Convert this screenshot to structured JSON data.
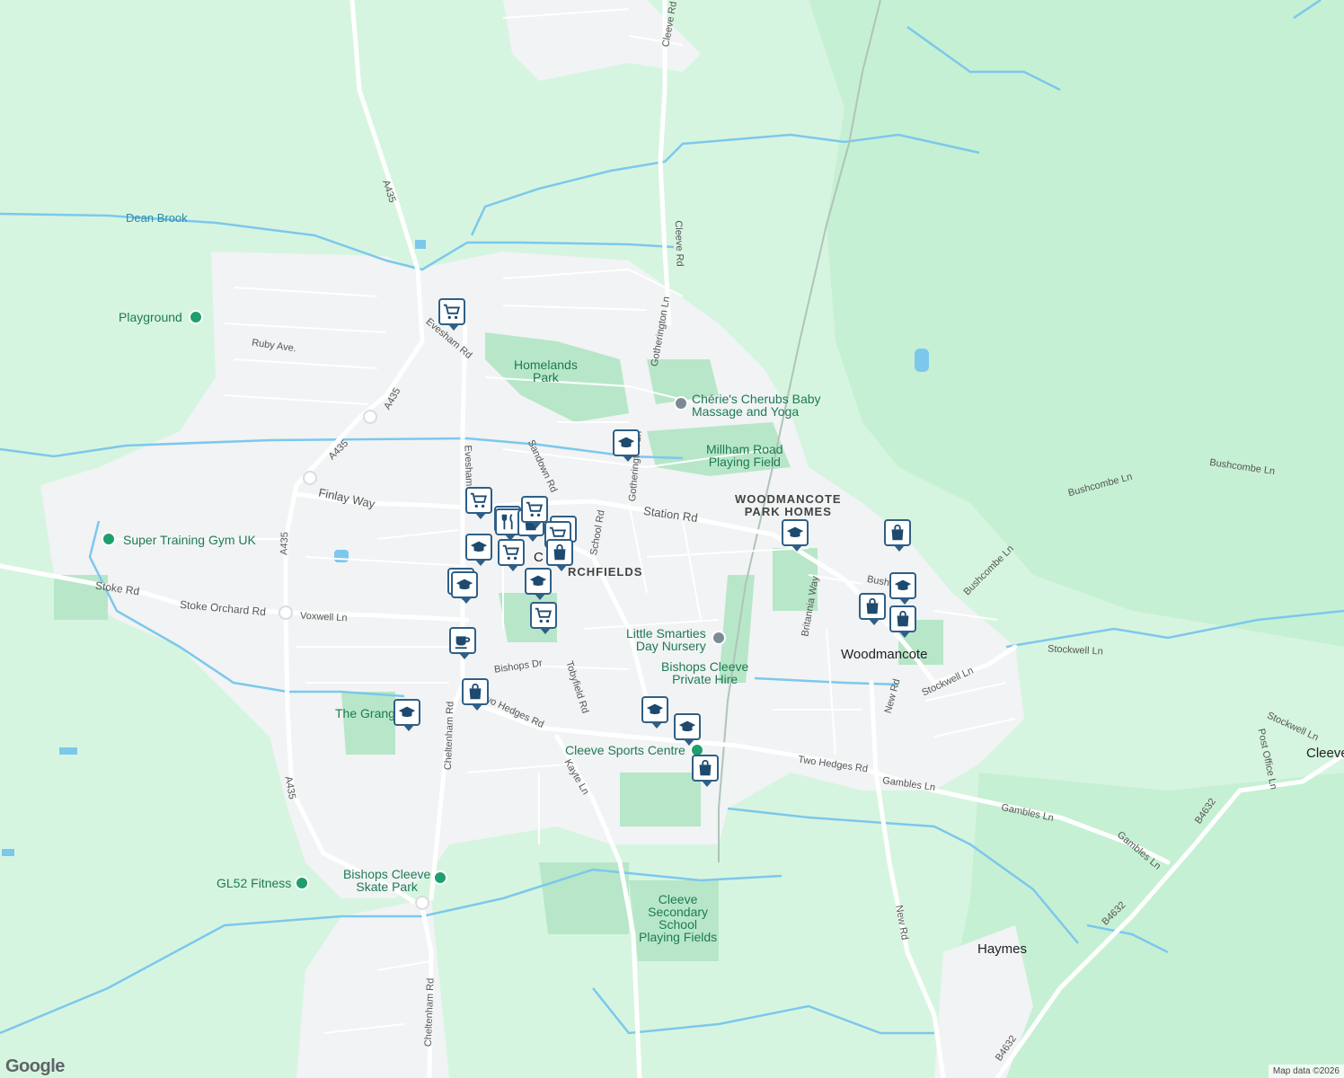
{
  "map": {
    "colors": {
      "land": "#d6f5e0",
      "urban": "#f1f3f4",
      "park": "#b7e7c8",
      "woods": "#c6f0d4",
      "water": "#7cc8ec",
      "road": "#ffffff",
      "road_major": "#dadce0"
    },
    "places": [
      {
        "text": "Homelands\nPark"
      },
      {
        "text": "Chérie's Cherubs Baby\nMassage and Yoga"
      },
      {
        "text": "Millham Road\nPlaying Field"
      },
      {
        "text": "WOODMANCOTE\nPARK HOMES"
      },
      {
        "text": "Playground"
      },
      {
        "text": "Super Training Gym UK"
      },
      {
        "text": "Little Smarties\nDay Nursery"
      },
      {
        "text": "Bishops Cleeve\nPrivate Hire"
      },
      {
        "text": "Woodmancote"
      },
      {
        "text": "The Grang"
      },
      {
        "text": "Cleeve Sports Centre"
      },
      {
        "text": "GL52 Fitness"
      },
      {
        "text": "Bishops Cleeve\nSkate Park"
      },
      {
        "text": "Cleeve\nSecondary\nSchool\nPlaying Fields"
      },
      {
        "text": "Haymes"
      },
      {
        "text": "Cleeve"
      },
      {
        "text": "Dean Brook"
      },
      {
        "text": "C"
      },
      {
        "text": "RCHFIELDS"
      }
    ],
    "roads": [
      {
        "text": "A435"
      },
      {
        "text": "A435"
      },
      {
        "text": "A435"
      },
      {
        "text": "A435"
      },
      {
        "text": "A435"
      },
      {
        "text": "Evesham Rd"
      },
      {
        "text": "Evesham Rd"
      },
      {
        "text": "Cleeve Rd"
      },
      {
        "text": "Cleeve Rd"
      },
      {
        "text": "Gotherington Ln"
      },
      {
        "text": "Gotherington Ln"
      },
      {
        "text": "Sandown Rd"
      },
      {
        "text": "School Rd"
      },
      {
        "text": "Station Rd"
      },
      {
        "text": "Finlay Way"
      },
      {
        "text": "Ruby Ave."
      },
      {
        "text": "Stoke Rd"
      },
      {
        "text": "Stoke Orchard Rd"
      },
      {
        "text": "Voxwell Ln"
      },
      {
        "text": "Bishops Dr"
      },
      {
        "text": "Tobyfield Rd"
      },
      {
        "text": "Two Hedges Rd"
      },
      {
        "text": "Two Hedges Rd"
      },
      {
        "text": "Cheltenham Rd"
      },
      {
        "text": "Cheltenham Rd"
      },
      {
        "text": "Kayte Ln"
      },
      {
        "text": "Britannia Way"
      },
      {
        "text": "Bushcombe Ln"
      },
      {
        "text": "Bushcombe Ln"
      },
      {
        "text": "Bushcombe Ln"
      },
      {
        "text": "Bush"
      },
      {
        "text": "Stockwell Ln"
      },
      {
        "text": "Stockwell Ln"
      },
      {
        "text": "Stockwell Ln"
      },
      {
        "text": "New Rd"
      },
      {
        "text": "New Rd"
      },
      {
        "text": "Gambles Ln"
      },
      {
        "text": "Gambles Ln"
      },
      {
        "text": "Gambles Ln"
      },
      {
        "text": "Post Office Ln"
      },
      {
        "text": "B4632"
      },
      {
        "text": "B4632"
      },
      {
        "text": "B4632"
      }
    ],
    "markers": [
      "shopping-cart-icon",
      "graduation-cap-icon",
      "shopping-cart-icon",
      "shopping-cart-icon",
      "restaurant-icon",
      "shopping-bag-icon",
      "shopping-cart-icon",
      "graduation-cap-icon",
      "shopping-cart-icon",
      "shopping-bag-icon",
      "graduation-cap-icon",
      "graduation-cap-icon",
      "graduation-cap-icon",
      "shopping-cart-icon",
      "cafe-icon",
      "shopping-bag-icon",
      "graduation-cap-icon",
      "graduation-cap-icon",
      "graduation-cap-icon",
      "shopping-cart-icon",
      "graduation-cap-icon",
      "shopping-bag-icon",
      "graduation-cap-icon",
      "shopping-bag-icon",
      "graduation-cap-icon",
      "shopping-bag-icon",
      "shopping-bag-icon"
    ]
  },
  "branding": {
    "logo": "Google",
    "attribution": "Map data ©2026"
  }
}
